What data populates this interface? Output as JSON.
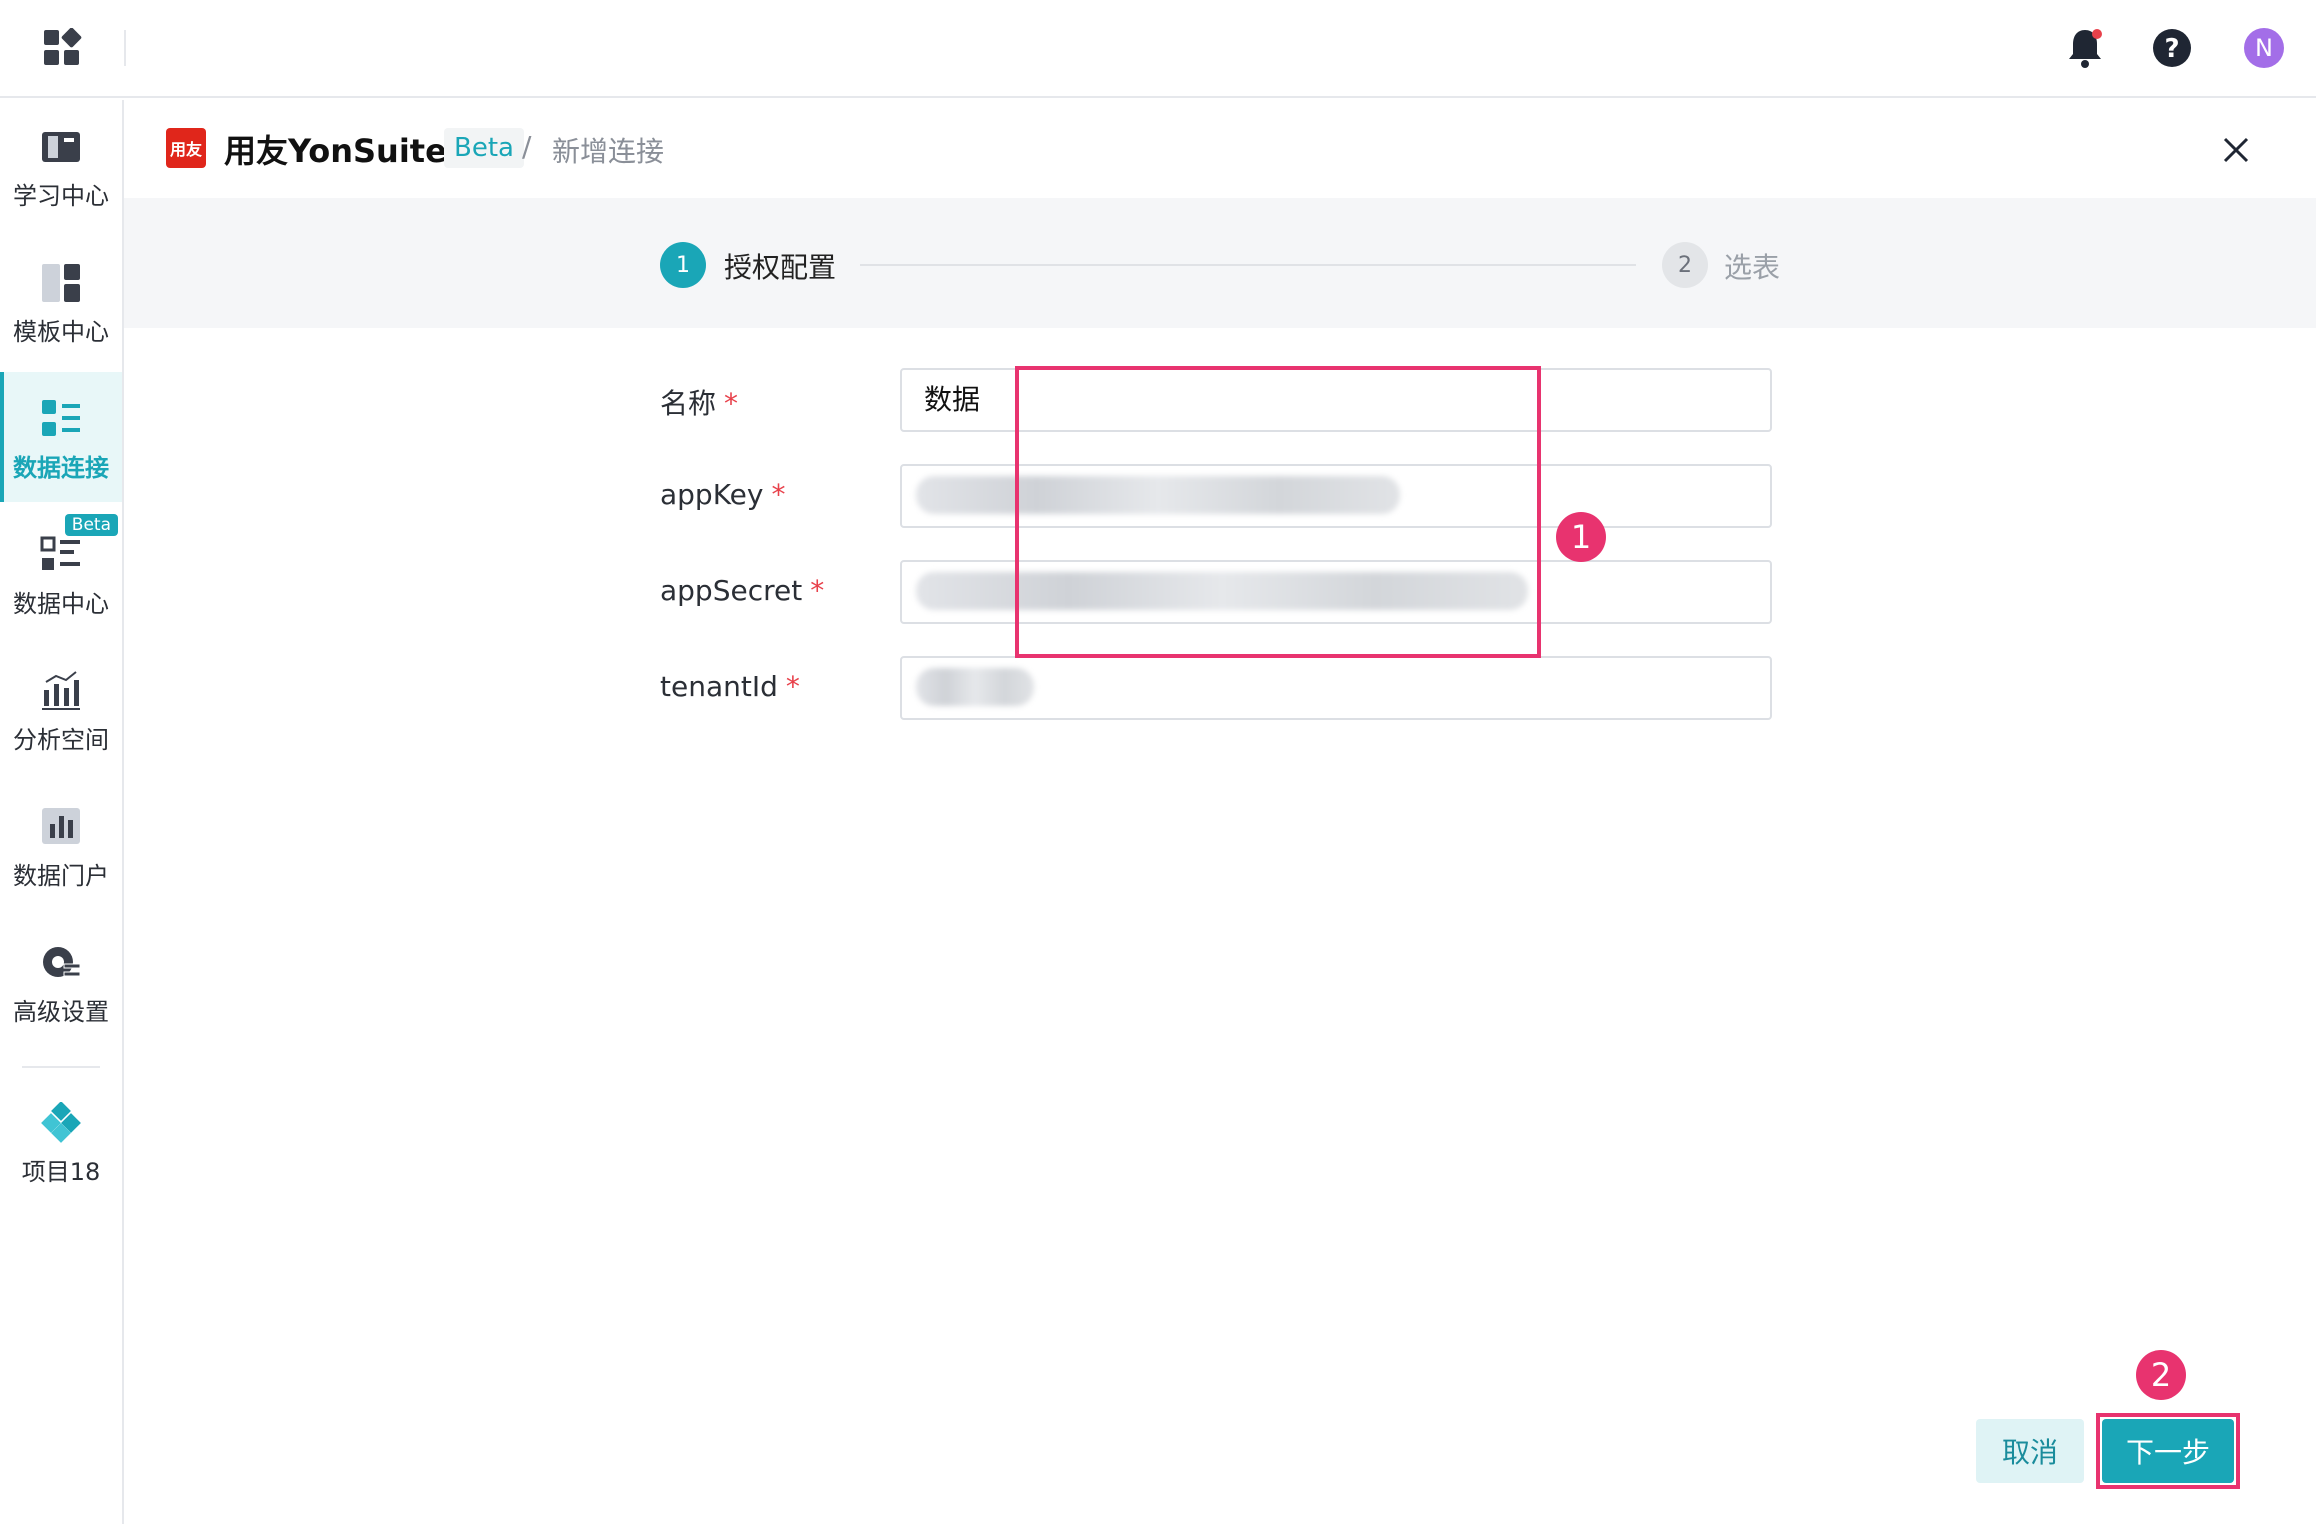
{
  "topbar": {
    "avatar_initial": "N"
  },
  "sidebar": {
    "items": [
      {
        "label": "学习中心",
        "icon": "learning-center-icon"
      },
      {
        "label": "模板中心",
        "icon": "template-center-icon"
      },
      {
        "label": "数据连接",
        "icon": "data-connection-icon",
        "active": true
      },
      {
        "label": "数据中心",
        "icon": "data-center-icon",
        "badge": "Beta"
      },
      {
        "label": "分析空间",
        "icon": "analysis-space-icon"
      },
      {
        "label": "数据门户",
        "icon": "data-portal-icon"
      },
      {
        "label": "高级设置",
        "icon": "advanced-settings-icon"
      },
      {
        "label": "项目18",
        "icon": "project-icon"
      }
    ]
  },
  "header": {
    "brand": "用友YonSuite",
    "brand_logo_text": "用友",
    "beta": "Beta",
    "separator": "/",
    "current": "新增连接"
  },
  "steps": [
    {
      "number": "1",
      "label": "授权配置",
      "active": true
    },
    {
      "number": "2",
      "label": "选表",
      "active": false
    }
  ],
  "form": {
    "fields": [
      {
        "label": "名称",
        "required": "*",
        "value": "数据"
      },
      {
        "label": "appKey",
        "required": "*",
        "value": ""
      },
      {
        "label": "appSecret",
        "required": "*",
        "value": ""
      },
      {
        "label": "tenantId",
        "required": "*",
        "value": ""
      }
    ]
  },
  "annotations": {
    "marker1": "1",
    "marker2": "2"
  },
  "footer": {
    "cancel_label": "取消",
    "next_label": "下一步"
  },
  "colors": {
    "accent": "#1aa6b7",
    "annotation": "#e8336f",
    "brand_red": "#e0261b",
    "avatar": "#a36ee8"
  }
}
